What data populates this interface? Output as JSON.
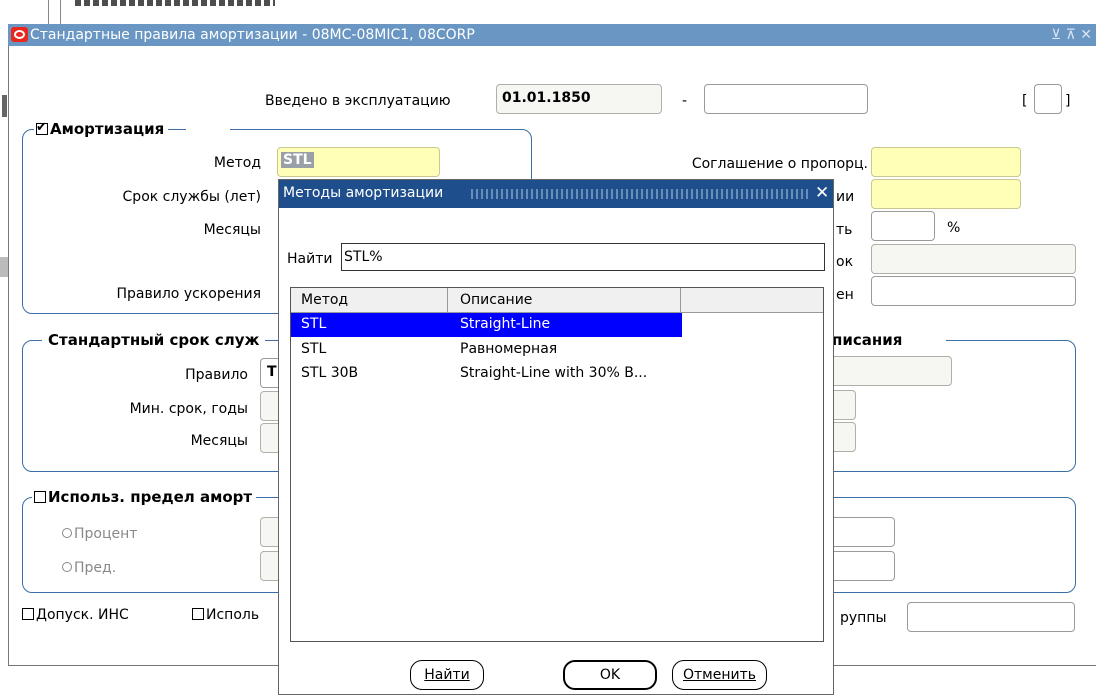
{
  "main_window": {
    "title": "Стандартные правила амортизации - 08MC-08MIC1, 08CORP",
    "title_controls": "⊻ ⊼ ✕",
    "in_service_label": "Введено в эксплуатацию",
    "in_service_date": "01.01.1850",
    "dash": "-",
    "bracket_open": "[",
    "bracket_close": "]",
    "depreciation_group": {
      "checkbox_label": "Амортизация",
      "method_label": "Метод",
      "method_value": "STL",
      "life_years_label": "Срок службы (лет)",
      "months_label": "Месяцы",
      "accel_rule_label": "Правило ускорения"
    },
    "right_fields": {
      "prorate_label": "Соглашение о пропорц.",
      "partial_label_1": "ии",
      "partial_label_2": "ть",
      "percent_sign": "%",
      "partial_label_3": "ок",
      "partial_label_4": "ен"
    },
    "std_life_group": {
      "title": "Стандартный срок служ",
      "rule_label": "Правило",
      "rule_partial": "Т",
      "min_life_label": "Мин. срок, годы",
      "months_label": "Месяцы",
      "writeoff_title": "писания"
    },
    "limit_group": {
      "checkbox_label": "Использ. предел аморт",
      "percent_radio": "Процент",
      "limit_radio": "Пред."
    },
    "bottom": {
      "allow_ins": "Допуск. ИНС",
      "use_partial": "Исполь",
      "groups_partial": "руппы"
    }
  },
  "lov_dialog": {
    "title": "Методы амортизации",
    "find_label": "Найти",
    "find_value": "STL%",
    "columns": [
      "Метод",
      "Описание"
    ],
    "rows": [
      {
        "method": "STL",
        "description": "Straight-Line",
        "selected": true
      },
      {
        "method": "STL",
        "description": "Равномерная",
        "selected": false
      },
      {
        "method": "STL 30B",
        "description": "Straight-Line with 30% B...",
        "selected": false
      }
    ],
    "find_button": "Найти",
    "ok_button": "OK",
    "cancel_button": "Отменить"
  },
  "colors": {
    "titlebar": "#6a96c3",
    "dialog_titlebar": "#1e4f8c",
    "selection": "#0000ff",
    "required_field": "#ffffb8",
    "oracle_logo": "#e8281e"
  }
}
